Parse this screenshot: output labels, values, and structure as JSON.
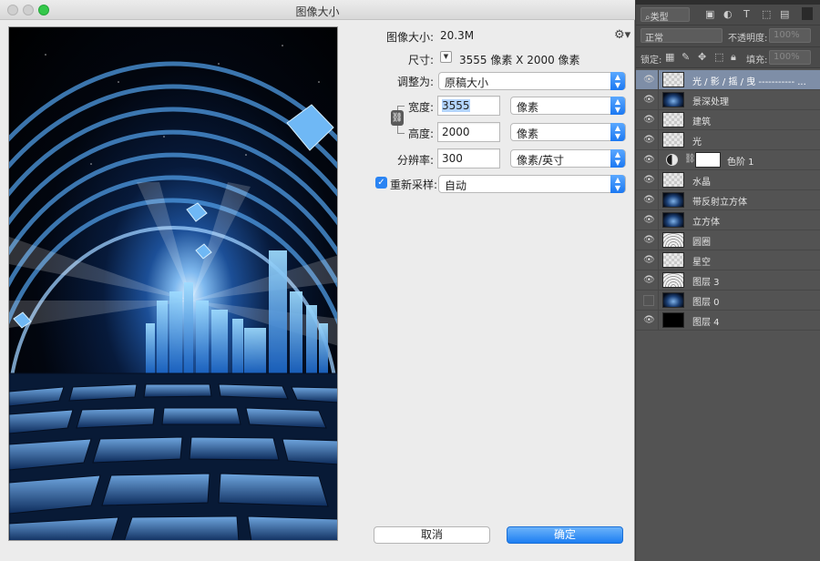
{
  "dialog": {
    "title": "图像大小",
    "image_size_label": "图像大小:",
    "image_size_value": "20.3M",
    "dimensions_label": "尺寸:",
    "dimensions_value": "3555 像素  X  2000 像素",
    "fit_to_label": "调整为:",
    "fit_to_value": "原稿大小",
    "width_label": "宽度:",
    "width_value": "3555",
    "width_unit": "像素",
    "height_label": "高度:",
    "height_value": "2000",
    "height_unit": "像素",
    "resolution_label": "分辨率:",
    "resolution_value": "300",
    "resolution_unit": "像素/英寸",
    "resample_label": "重新采样:",
    "resample_checked": true,
    "resample_value": "自动",
    "cancel_label": "取消",
    "ok_label": "确定",
    "gear_icon": "gear-icon",
    "accent_color": "#1d7ef2"
  },
  "layers_panel": {
    "filter_kind": "类型",
    "blend_mode": "正常",
    "opacity_label": "不透明度:",
    "opacity_value": "100%",
    "lock_label": "锁定:",
    "fill_label": "填充:",
    "fill_value": "100%",
    "layers": [
      {
        "name": "光 / 影 / 摇 / 曳 ----------- ...",
        "visible": true,
        "thumb": "transparent",
        "active": true
      },
      {
        "name": "景深处理",
        "visible": true,
        "thumb": "dark"
      },
      {
        "name": "建筑",
        "visible": true,
        "thumb": "transparent"
      },
      {
        "name": "光",
        "visible": true,
        "thumb": "transparent"
      },
      {
        "name": "色阶 1",
        "visible": true,
        "thumb": "adjustment"
      },
      {
        "name": "水晶",
        "visible": true,
        "thumb": "transparent"
      },
      {
        "name": "带反射立方体",
        "visible": true,
        "thumb": "dark"
      },
      {
        "name": "立方体",
        "visible": true,
        "thumb": "dark"
      },
      {
        "name": "圆圈",
        "visible": true,
        "thumb": "rings"
      },
      {
        "name": "星空",
        "visible": true,
        "thumb": "transparent"
      },
      {
        "name": "图层 3",
        "visible": true,
        "thumb": "rings"
      },
      {
        "name": "图层 0",
        "visible": false,
        "thumb": "dark"
      },
      {
        "name": "图层 4",
        "visible": true,
        "thumb": "black"
      }
    ]
  }
}
